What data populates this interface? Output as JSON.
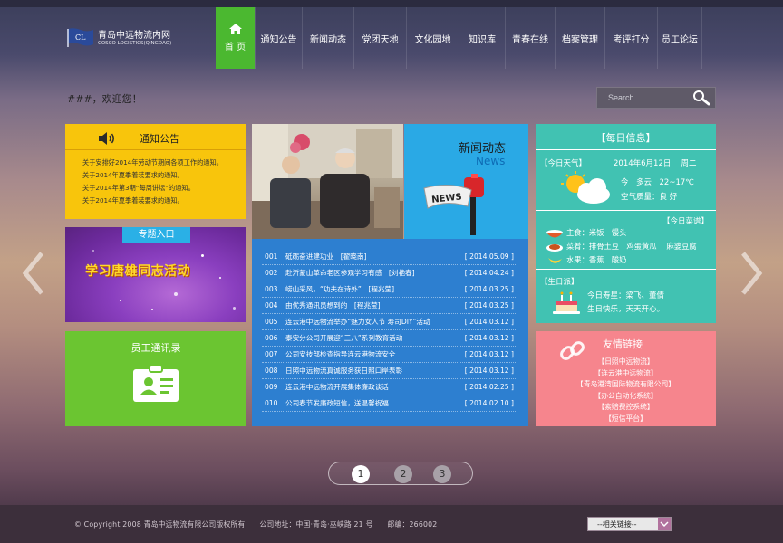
{
  "site": {
    "title_cn": "青岛中远物流内网",
    "title_en": "COSCO LOGISTICS(QINGDAO)"
  },
  "nav": {
    "items": [
      {
        "label": "首 页",
        "active": true
      },
      {
        "label": "通知公告"
      },
      {
        "label": "新闻动态"
      },
      {
        "label": "党团天地"
      },
      {
        "label": "文化园地"
      },
      {
        "label": "知识库"
      },
      {
        "label": "青春在线"
      },
      {
        "label": "档案管理"
      },
      {
        "label": "考评打分"
      },
      {
        "label": "员工论坛"
      }
    ]
  },
  "welcome": "###，欢迎您！",
  "search": {
    "placeholder": "Search"
  },
  "notice": {
    "title": "通知公告",
    "items": [
      "关于安排好2014年劳动节期间各项工作的通知。",
      "关于2014年夏季着装要求的通知。",
      "关于2014年第3期“每周讲坛”的通知。",
      "关于2014年夏季着装要求的通知。"
    ]
  },
  "topic": {
    "tag": "专题入口",
    "banner": "学习唐雄同志活动"
  },
  "staff": {
    "title": "员工通讯录"
  },
  "news_head": {
    "title_cn": "新闻动态",
    "title_en": "News",
    "mailbox_label": "NEWS"
  },
  "news": [
    {
      "no": "001",
      "title": "砥砺奋进建功业　[翟晓南]",
      "date": "[ 2014.05.09 ]"
    },
    {
      "no": "002",
      "title": "赴沂蒙山革命老区参观学习有感　[刘艳春]",
      "date": "[ 2014.04.24 ]"
    },
    {
      "no": "003",
      "title": "崂山采风，“功夫在诗外”　[程兆莹]",
      "date": "[ 2014.03.25 ]"
    },
    {
      "no": "004",
      "title": "由优秀通讯员想到的　[程兆莹]",
      "date": "[ 2014.03.25 ]"
    },
    {
      "no": "005",
      "title": "连云港中远物流举办“魅力女人节 寿司DIY”活动",
      "date": "[ 2014.03.12 ]"
    },
    {
      "no": "006",
      "title": "泰安分公司开展迎“三八”系列教育活动",
      "date": "[ 2014.03.12 ]"
    },
    {
      "no": "007",
      "title": "公司安技部检查指导连云港物流安全",
      "date": "[ 2014.03.12 ]"
    },
    {
      "no": "008",
      "title": "日照中远物流真诚服务获日照口岸表彰",
      "date": "[ 2014.03.12 ]"
    },
    {
      "no": "009",
      "title": "连云港中远物流开展集体廉政谈话",
      "date": "[ 2014.02.25 ]"
    },
    {
      "no": "010",
      "title": "公司春节发廉政短信，送温馨祝福",
      "date": "[ 2014.02.10 ]"
    }
  ],
  "daily": {
    "title": "【每日信息】",
    "weather_label": "【今日天气】",
    "date": "2014年6月12日　 周二",
    "weather": "今　多云　22~17℃",
    "air": "空气质量：良 好",
    "menu_label": "【今日菜谱】",
    "menu": [
      "主食：米饭　馒头",
      "菜肴：排骨土豆　鸡蛋黄瓜　 麻婆豆腐",
      "水果：香蕉　酸奶"
    ],
    "birthday_label": "【生日派】",
    "birthday_line1": "今日寿星：梁飞、董倩",
    "birthday_line2": "生日快乐，天天开心。"
  },
  "links": {
    "title": "友情链接",
    "items": [
      "【日照中远物流】",
      "【连云港中远物流】",
      "【青岛港湾国际物流有限公司】",
      "【办公自动化系统】",
      "【索赔费控系统】",
      "【短信平台】"
    ]
  },
  "pager": {
    "pages": [
      "1",
      "2",
      "3"
    ],
    "current": 1
  },
  "footer": {
    "copyright": "© Copyright 2008 青岛中远物流有限公司版权所有　　公司地址：中国·青岛·巫峡路 21 号　　邮编：266002",
    "select_value": "--相关链接--"
  },
  "colors": {
    "nav_active": "#4bb830",
    "notice": "#f8c50c",
    "staff": "#6bc531",
    "news": "#2d7fd0",
    "news_head": "#2aa9e5",
    "daily": "#41c2b2",
    "links": "#f6858d"
  }
}
